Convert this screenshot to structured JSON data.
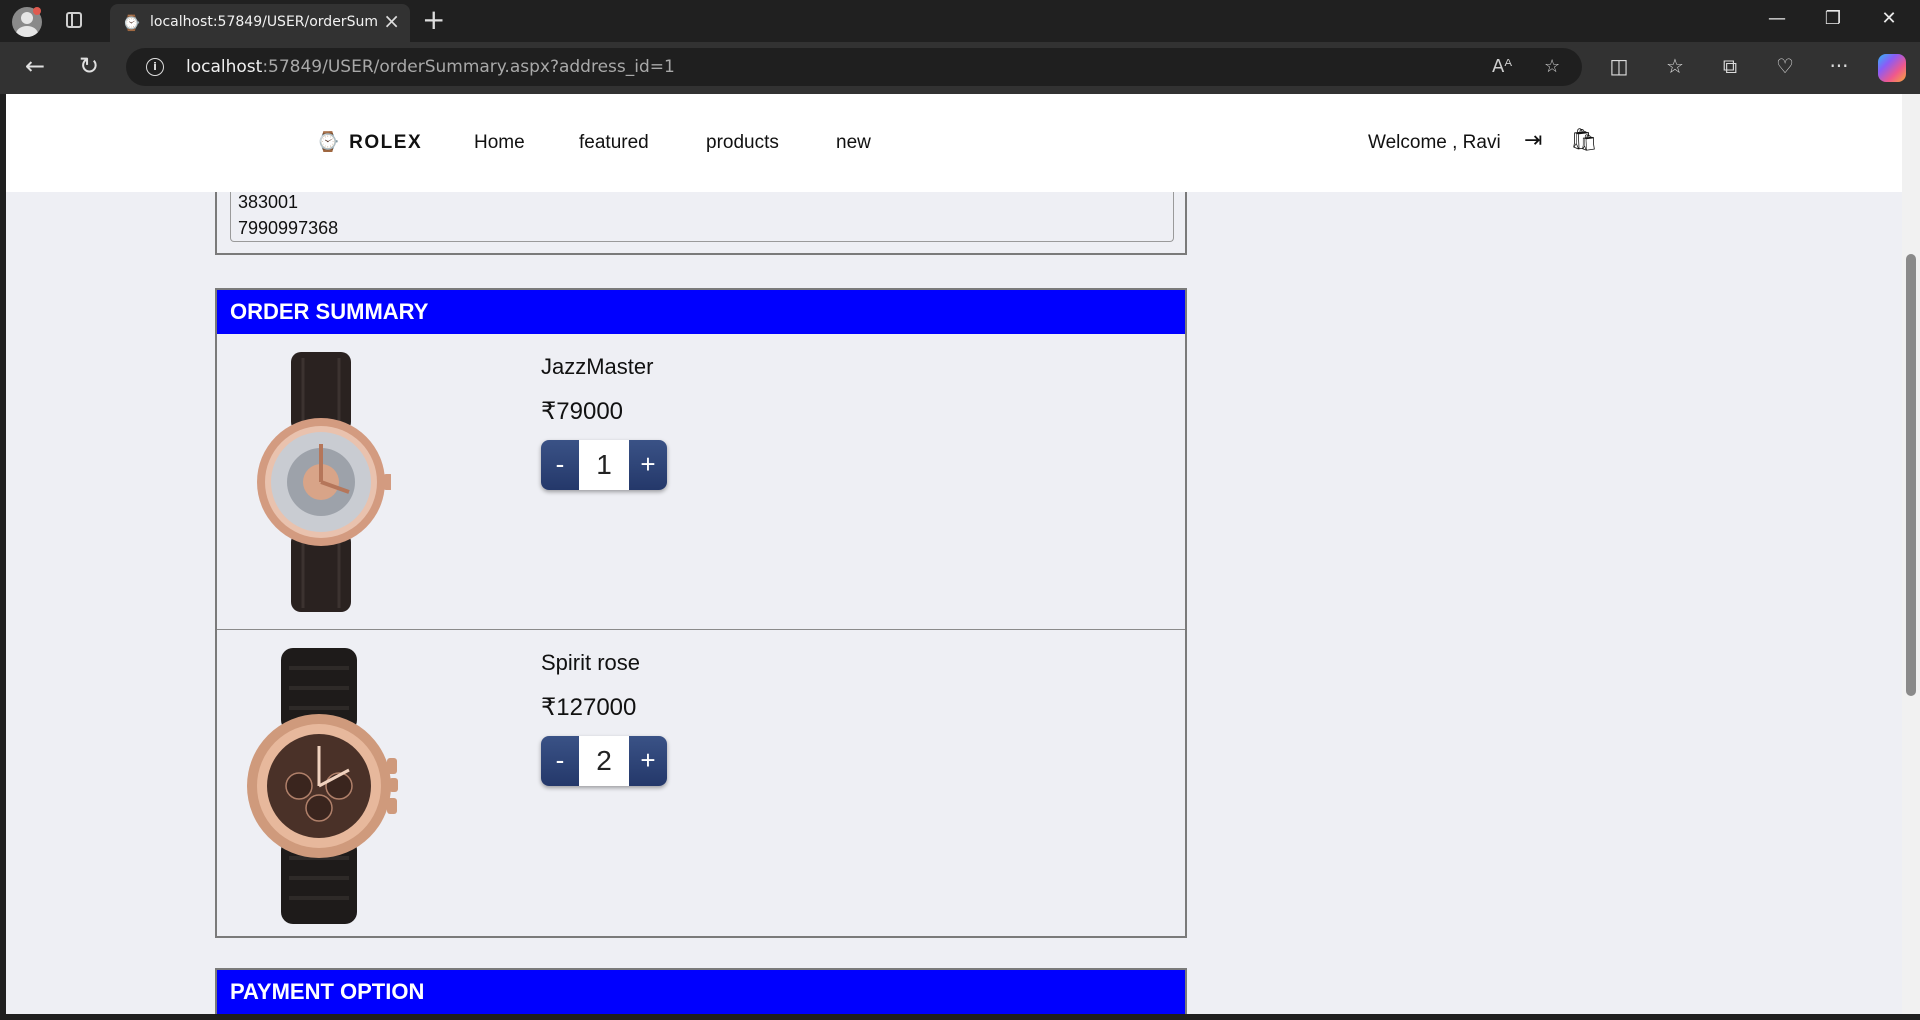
{
  "browser": {
    "tab_title": "localhost:57849/USER/orderSumm",
    "url_host": "localhost",
    "url_rest": ":57849/USER/orderSummary.aspx?address_id=1"
  },
  "site": {
    "brand": "ROLEX",
    "nav": [
      "Home",
      "featured",
      "products",
      "new"
    ],
    "welcome": "Welcome , Ravi"
  },
  "address": {
    "pincode": "383001",
    "phone": "7990997368"
  },
  "order_summary": {
    "heading": "ORDER SUMMARY",
    "items": [
      {
        "name": "JazzMaster",
        "price": "₹79000",
        "qty": "1",
        "minus": "-",
        "plus": "+"
      },
      {
        "name": "Spirit rose",
        "price": "₹127000",
        "qty": "2",
        "minus": "-",
        "plus": "+"
      }
    ]
  },
  "payment": {
    "heading": "PAYMENT OPTION"
  },
  "colors": {
    "section_header": "#0000ff",
    "stepper": "#2c4178",
    "page_bg": "#eeeff4"
  }
}
